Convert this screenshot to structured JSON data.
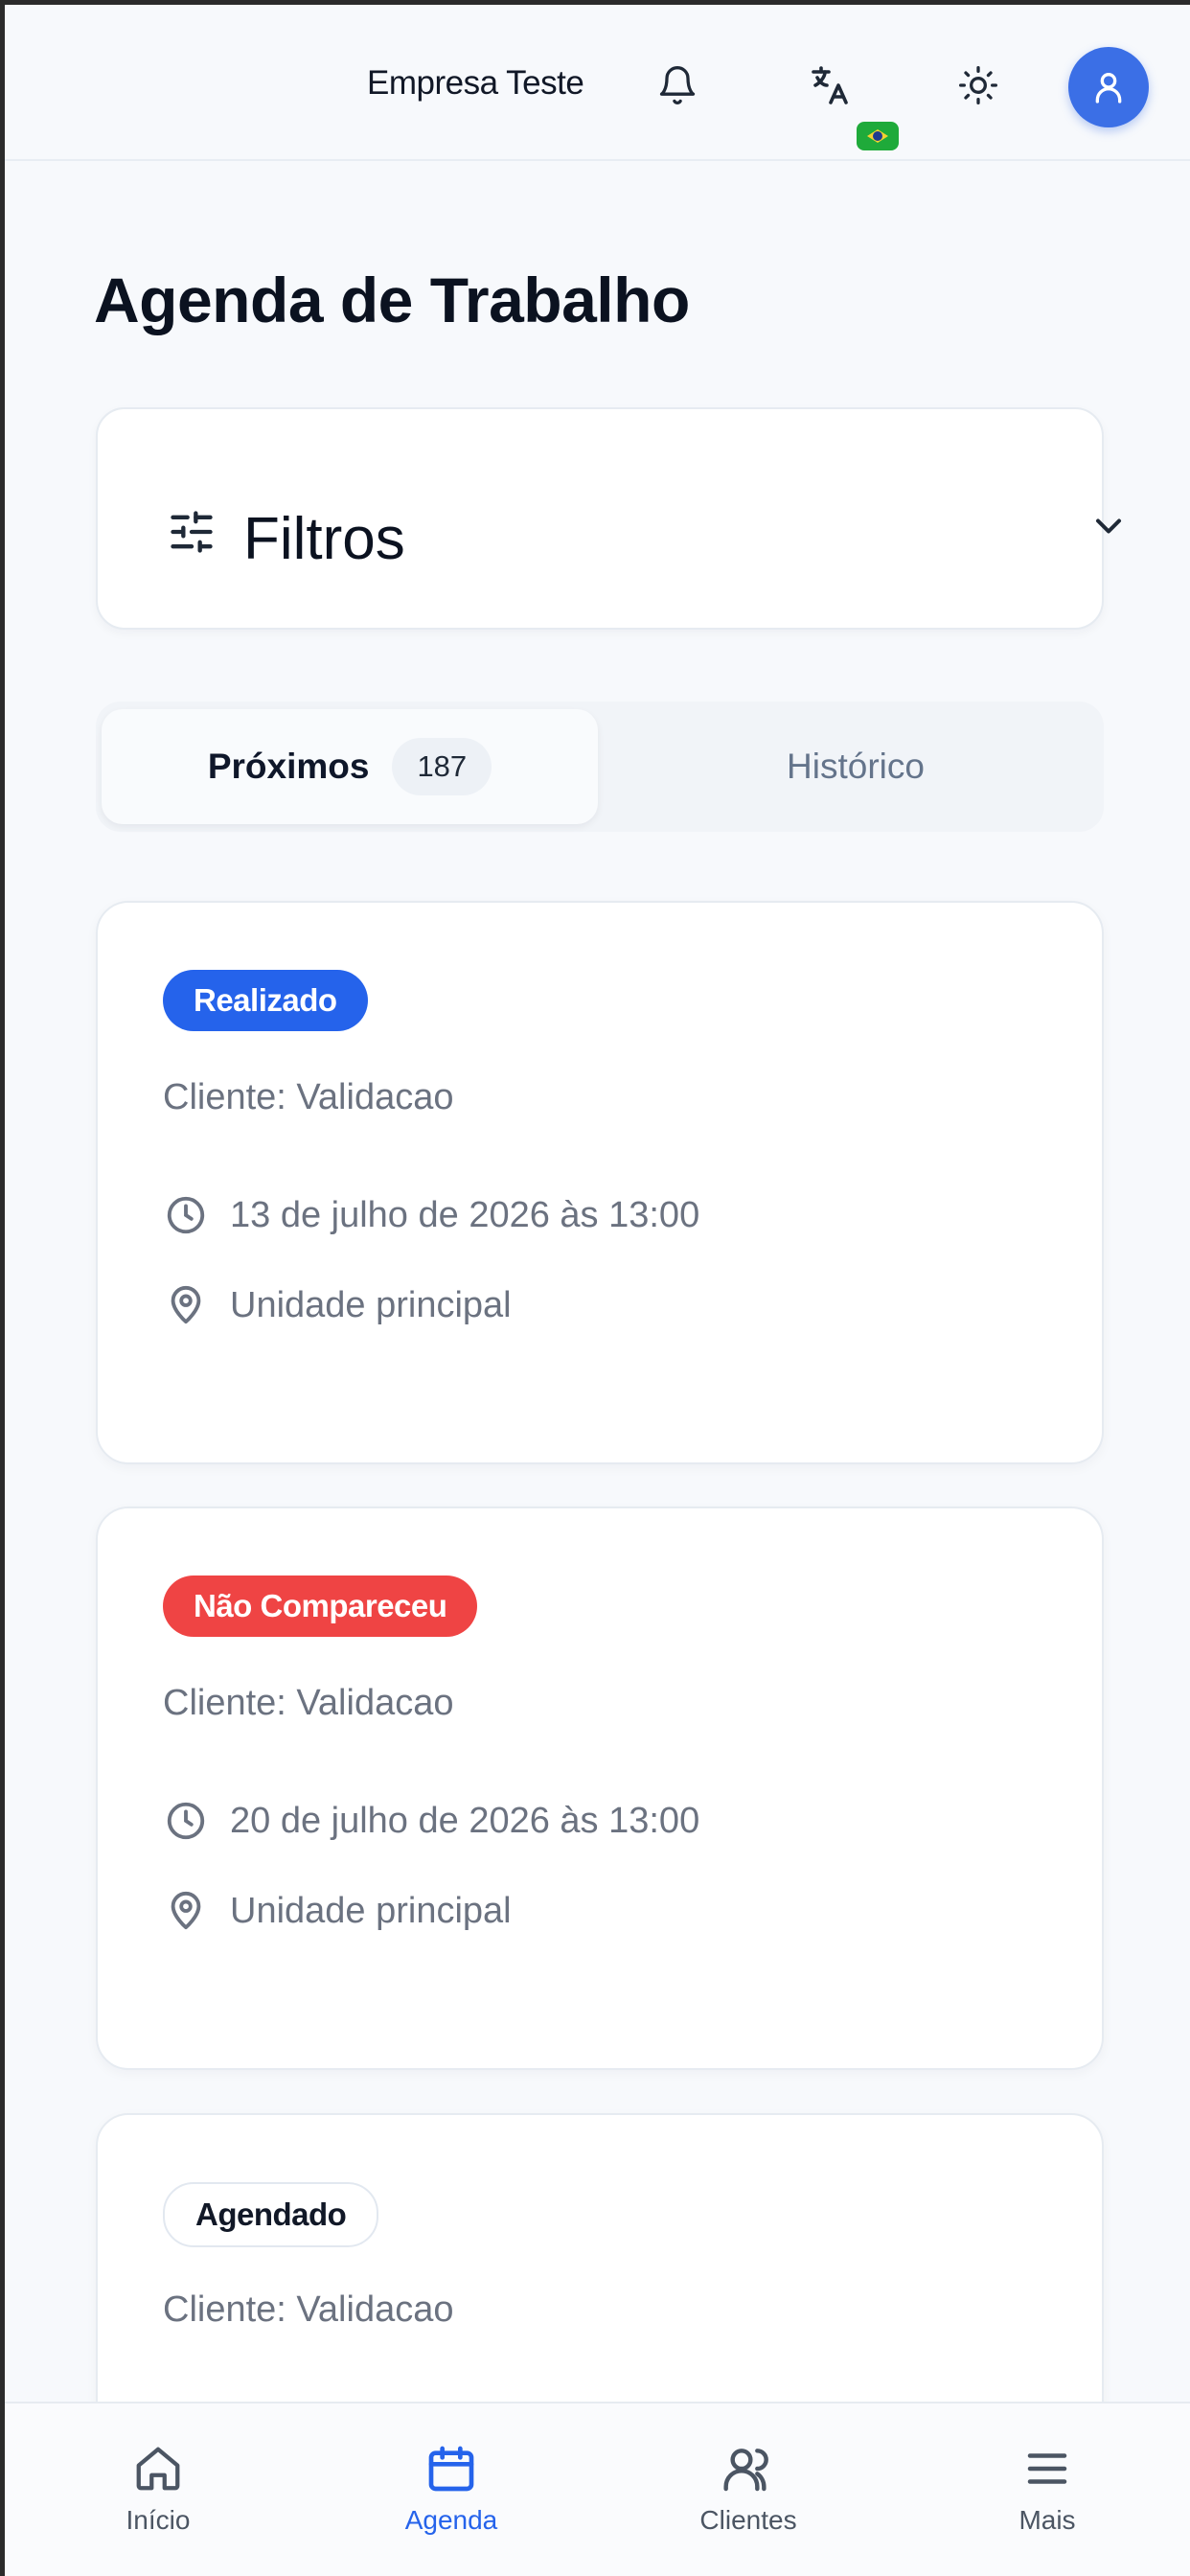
{
  "header": {
    "company": "Empresa Teste",
    "icons": [
      "bell-icon",
      "translate-icon",
      "sun-icon",
      "user-icon"
    ],
    "language_flag": "brazil-flag"
  },
  "page": {
    "title": "Agenda de Trabalho"
  },
  "filters": {
    "label": "Filtros",
    "icon": "sliders-icon",
    "toggle_icon": "chevron-down-icon"
  },
  "tabs": {
    "upcoming_label": "Próximos",
    "upcoming_count": "187",
    "history_label": "Histórico"
  },
  "appointments": [
    {
      "status": "Realizado",
      "status_color": "#2563eb",
      "client": "Cliente: Validacao",
      "datetime": "13 de julho de 2026 às 13:00",
      "location": "Unidade principal"
    },
    {
      "status": "Não Compareceu",
      "status_color": "#ef4444",
      "client": "Cliente: Validacao",
      "datetime": "20 de julho de 2026 às 13:00",
      "location": "Unidade principal"
    },
    {
      "status": "Agendado",
      "status_color": "#ffffff",
      "client": "Cliente: Validacao"
    }
  ],
  "bottom_nav": [
    {
      "label": "Início",
      "icon": "home-icon"
    },
    {
      "label": "Agenda",
      "icon": "calendar-icon",
      "active": true
    },
    {
      "label": "Clientes",
      "icon": "users-icon"
    },
    {
      "label": "Mais",
      "icon": "menu-icon"
    }
  ],
  "colors": {
    "accent": "#2563eb",
    "danger": "#ef4444",
    "background": "#f7f9fc",
    "muted_text": "#6b7280"
  }
}
